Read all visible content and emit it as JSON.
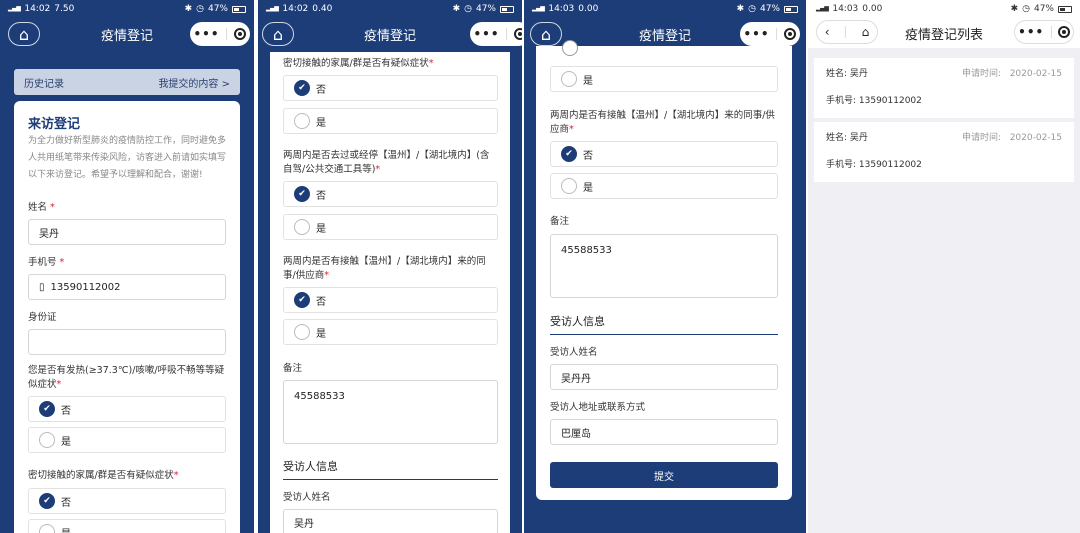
{
  "status": {
    "p1": {
      "time": "14:02",
      "speed": "7.50",
      "battery": "47%"
    },
    "p2": {
      "time": "14:02",
      "speed": "0.40",
      "battery": "47%"
    },
    "p3": {
      "time": "14:03",
      "speed": "0.00",
      "battery": "47%"
    },
    "p4": {
      "time": "14:03",
      "speed": "0.00",
      "battery": "47%"
    }
  },
  "nav": {
    "title": "疫情登记",
    "list_title": "疫情登记列表",
    "capsule_more": "•••"
  },
  "p1": {
    "history": "历史记录",
    "my_content": "我提交的内容 >",
    "form_title": "来访登记",
    "desc": "为全力做好新型肺炎的疫情防控工作，同时避免多人共用纸笔带来传染风险，访客进入前请如实填写以下来访登记。希望予以理解和配合，谢谢!",
    "name_label": "姓名",
    "name_value": "吴丹",
    "phone_label": "手机号",
    "phone_value": "13590112002",
    "id_label": "身份证",
    "fever_q": "您是否有发热(≥37.3℃)/咳嗽/呼吸不畅等等疑似症状",
    "close_q": "密切接触的家属/群是否有疑似症状"
  },
  "p2": {
    "close_q": "密切接触的家属/群是否有疑似症状",
    "travel_q": "两周内是否去过或经停【温州】/【湖北境内】(含自驾/公共交通工具等)",
    "contact_q": "两周内是否有接触【温州】/【湖北境内】来的同事/供应商",
    "remark_label": "备注",
    "remark_value": "45588533",
    "section_title": "受访人信息",
    "host_name_label": "受访人姓名",
    "host_name_value": "吴丹"
  },
  "p3": {
    "contact_q": "两周内是否有接触【温州】/【湖北境内】来的同事/供应商",
    "remark_label": "备注",
    "remark_value": "45588533",
    "section_title": "受访人信息",
    "host_name_label": "受访人姓名",
    "host_name_value": "吴丹丹",
    "host_addr_label": "受访人地址或联系方式",
    "host_addr_value": "巴厘岛",
    "submit": "提交"
  },
  "options": {
    "no": "否",
    "yes": "是"
  },
  "records": [
    {
      "name": "姓名: 吴丹",
      "time_label": "申请时间:",
      "time": "2020-02-15",
      "phone": "手机号: 13590112002"
    },
    {
      "name": "姓名: 吴丹",
      "time_label": "申请时间:",
      "time": "2020-02-15",
      "phone": "手机号: 13590112002"
    }
  ]
}
